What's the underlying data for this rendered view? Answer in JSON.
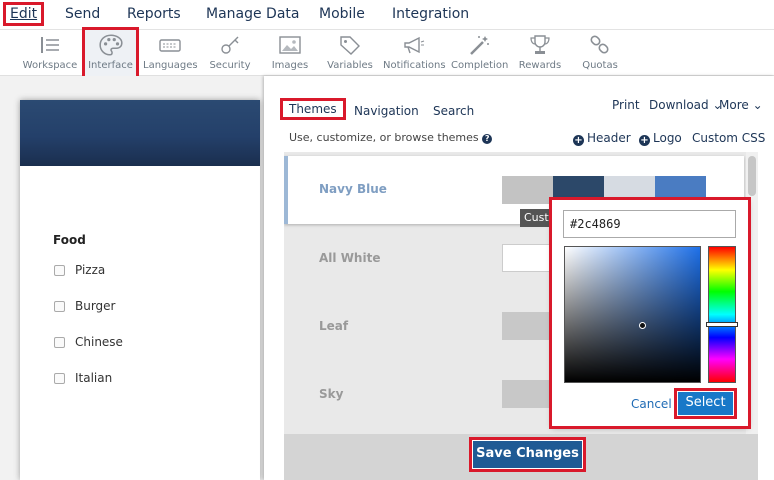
{
  "topmenu": {
    "items": [
      "Edit",
      "Send",
      "Reports",
      "Manage Data",
      "Mobile",
      "Integration"
    ]
  },
  "toolbar": {
    "tools": [
      {
        "label": "Workspace",
        "icon": "workspace-icon"
      },
      {
        "label": "Interface",
        "icon": "palette-icon"
      },
      {
        "label": "Languages",
        "icon": "keyboard-icon"
      },
      {
        "label": "Security",
        "icon": "key-icon"
      },
      {
        "label": "Images",
        "icon": "image-icon"
      },
      {
        "label": "Variables",
        "icon": "tag-icon"
      },
      {
        "label": "Notifications",
        "icon": "megaphone-icon"
      },
      {
        "label": "Completion",
        "icon": "magic-wand-icon"
      },
      {
        "label": "Rewards",
        "icon": "trophy-icon"
      },
      {
        "label": "Quotas",
        "icon": "link-icon"
      }
    ]
  },
  "preview": {
    "question": "Food",
    "options": [
      "Pizza",
      "Burger",
      "Chinese",
      "Italian"
    ]
  },
  "panel": {
    "tabs": [
      "Themes",
      "Navigation",
      "Search"
    ],
    "links": {
      "print": "Print",
      "download": "Download",
      "more": "More"
    },
    "subtitle": "Use, customize, or browse themes",
    "header_link": "Header",
    "logo_link": "Logo",
    "css_link": "Custom CSS",
    "themes": [
      {
        "name": "Navy Blue",
        "colors": [
          "#c3c3c3",
          "#2c4869",
          "#d6dbe2",
          "#4a7cc2"
        ]
      },
      {
        "name": "All White",
        "colors": [
          "#ffffff"
        ]
      },
      {
        "name": "Leaf",
        "colors": [
          "#c8c8c8"
        ]
      },
      {
        "name": "Sky",
        "colors": [
          "#c8c8c8"
        ]
      }
    ],
    "tooltip": "Custom",
    "save_label": "Save Changes"
  },
  "picker": {
    "hex_value": "#2c4869",
    "cancel_label": "Cancel",
    "select_label": "Select"
  },
  "colors": {
    "navy": "#1d3556",
    "highlight": "#d9192b",
    "button_blue": "#1878c8"
  }
}
